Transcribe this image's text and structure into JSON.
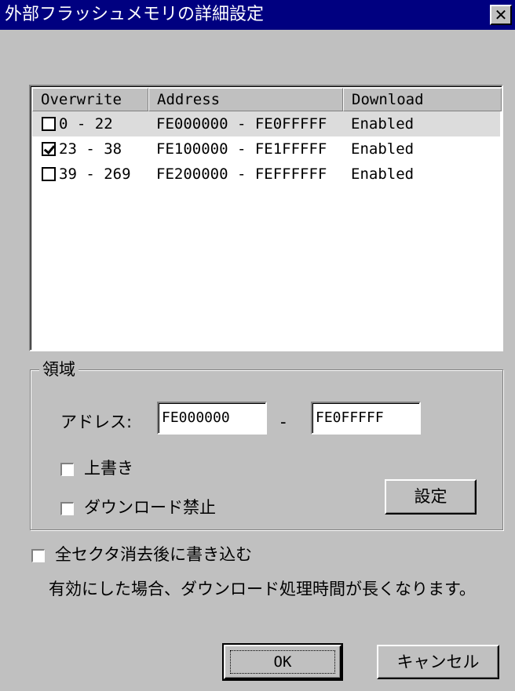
{
  "window": {
    "title": "外部フラッシュメモリの詳細設定",
    "close_label": "✕"
  },
  "list": {
    "columns": [
      "Overwrite",
      "Address",
      "Download"
    ],
    "rows": [
      {
        "range": "0 - 22",
        "address": "FE000000 - FE0FFFFF",
        "download": "Enabled",
        "checked": false
      },
      {
        "range": "23 - 38",
        "address": "FE100000 - FE1FFFFF",
        "download": "Enabled",
        "checked": true
      },
      {
        "range": "39 - 269",
        "address": "FE200000 - FEFFFFFF",
        "download": "Enabled",
        "checked": false
      }
    ]
  },
  "region": {
    "group_label": "領域",
    "address_label": "アドレス:",
    "start_address": "FE000000",
    "separator": "-",
    "end_address": "FE0FFFFF",
    "overwrite_label": "上書き",
    "overwrite_checked": false,
    "download_disable_label": "ダウンロード禁止",
    "download_disable_checked": false,
    "set_button": "設定"
  },
  "erase_all": {
    "label": "全セクタ消去後に書き込む",
    "checked": false,
    "note": "有効にした場合、ダウンロード処理時間が長くなります。"
  },
  "buttons": {
    "ok": "OK",
    "cancel": "キャンセル"
  }
}
